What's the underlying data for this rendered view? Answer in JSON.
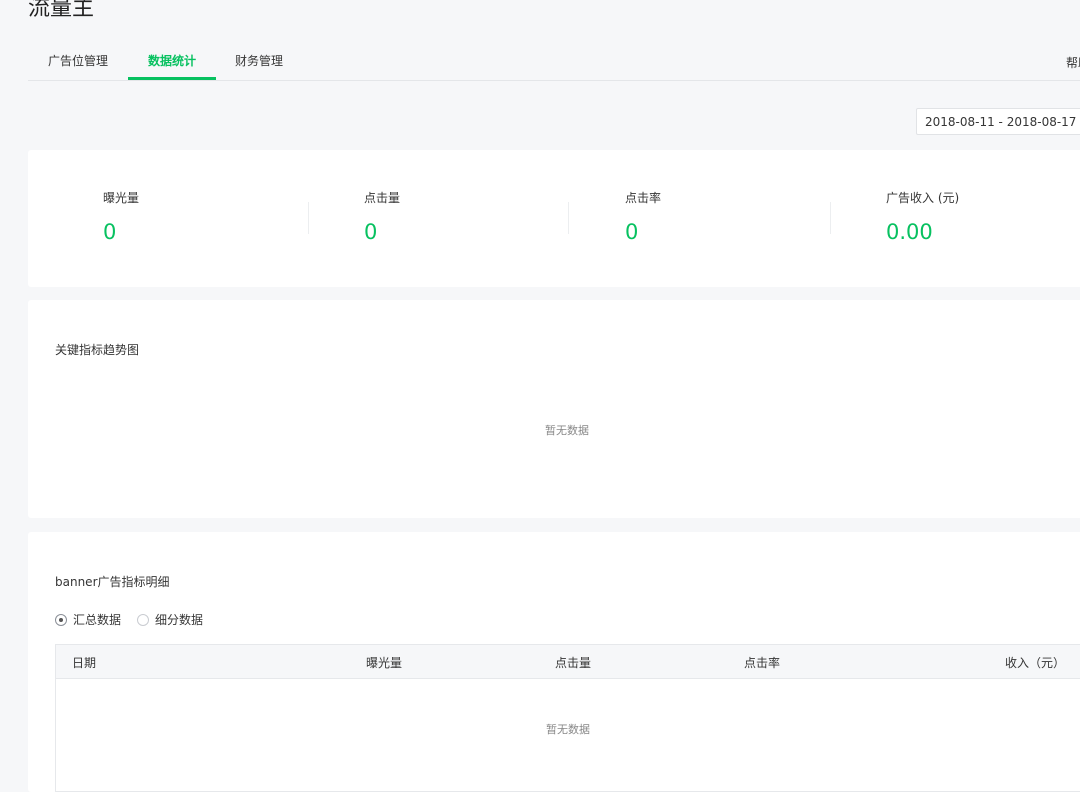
{
  "app": {
    "title": "流量主"
  },
  "tabs": [
    {
      "label": "广告位管理"
    },
    {
      "label": "数据统计"
    },
    {
      "label": "财务管理"
    }
  ],
  "help": {
    "label": "帮助"
  },
  "date_range": {
    "value": "2018-08-11 - 2018-08-17"
  },
  "metrics": [
    {
      "label": "曝光量",
      "value": "0"
    },
    {
      "label": "点击量",
      "value": "0"
    },
    {
      "label": "点击率",
      "value": "0"
    },
    {
      "label": "广告收入 (元)",
      "value": "0.00"
    }
  ],
  "trend": {
    "title": "关键指标趋势图",
    "empty": "暂无数据"
  },
  "detail": {
    "title": "banner广告指标明细",
    "options": [
      {
        "label": "汇总数据",
        "selected": true
      },
      {
        "label": "细分数据",
        "selected": false
      }
    ],
    "columns": [
      "日期",
      "曝光量",
      "点击量",
      "点击率",
      "收入（元）"
    ],
    "empty": "暂无数据"
  },
  "colors": {
    "accent": "#07c160",
    "background": "#f6f7f9"
  }
}
